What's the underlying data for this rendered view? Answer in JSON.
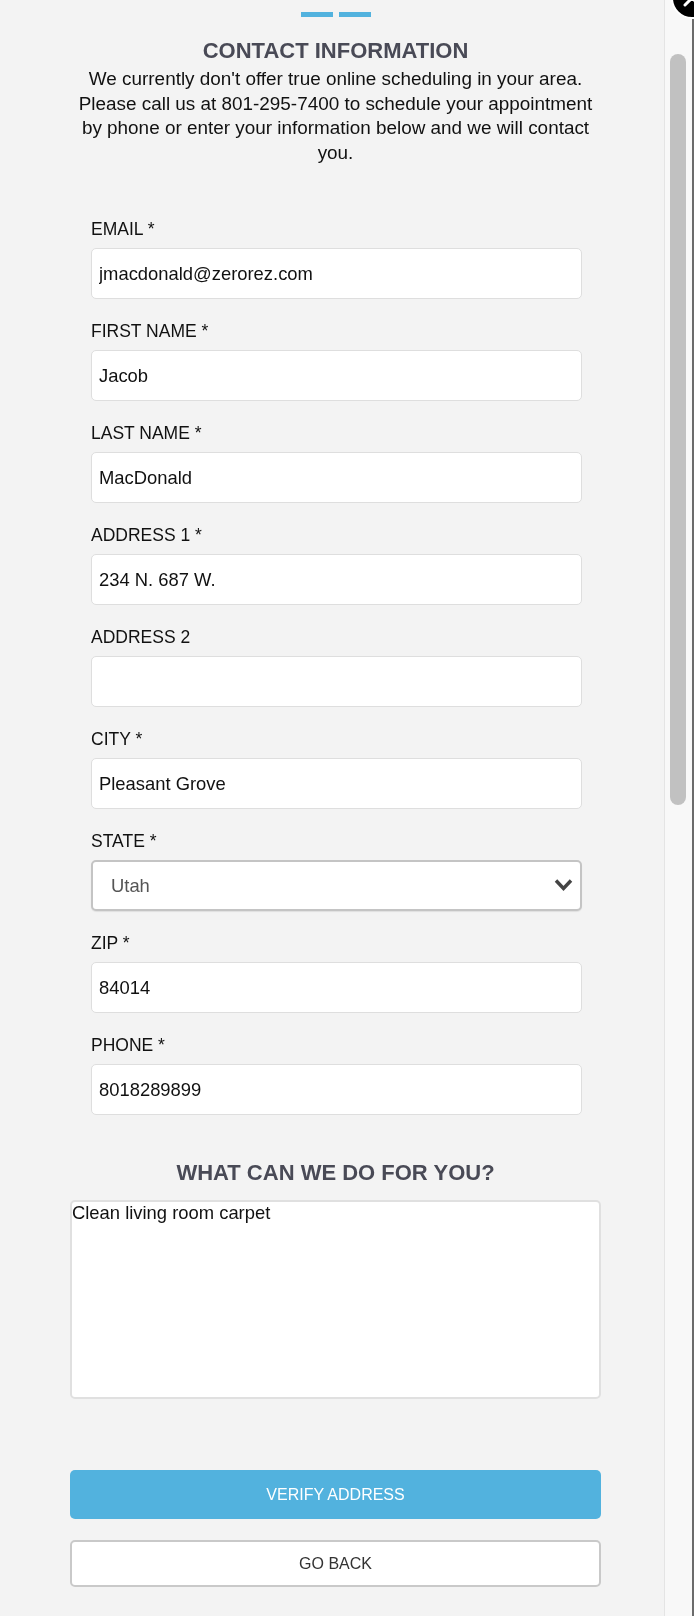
{
  "progress_steps": [
    {
      "done": true
    },
    {
      "done": true
    }
  ],
  "header": {
    "title": "CONTACT INFORMATION",
    "notice": "We currently don't offer true online scheduling in your area. Please call us at 801-295-7400 to schedule your appointment by phone or enter your information below and we will contact you."
  },
  "fields": [
    {
      "kind": "text",
      "label": "EMAIL *",
      "value": "jmacdonald@zerorez.com"
    },
    {
      "kind": "text",
      "label": "FIRST NAME *",
      "value": "Jacob"
    },
    {
      "kind": "text",
      "label": "LAST NAME *",
      "value": "MacDonald"
    },
    {
      "kind": "text",
      "label": "ADDRESS 1 *",
      "value": "234 N. 687 W."
    },
    {
      "kind": "text",
      "label": "ADDRESS 2"
    },
    {
      "kind": "text",
      "label": "CITY *",
      "value": "Pleasant Grove"
    },
    {
      "kind": "select",
      "label": "STATE *",
      "value": "Utah"
    },
    {
      "kind": "text",
      "label": "ZIP *",
      "value": "84014"
    },
    {
      "kind": "text",
      "label": "PHONE *",
      "value": "8018289899"
    }
  ],
  "request": {
    "title": "WHAT CAN WE DO FOR YOU?",
    "value": "Clean living room carpet"
  },
  "buttons": [
    {
      "kind": "primary",
      "label": "VERIFY ADDRESS"
    },
    {
      "kind": "secondary",
      "label": "GO BACK"
    }
  ]
}
